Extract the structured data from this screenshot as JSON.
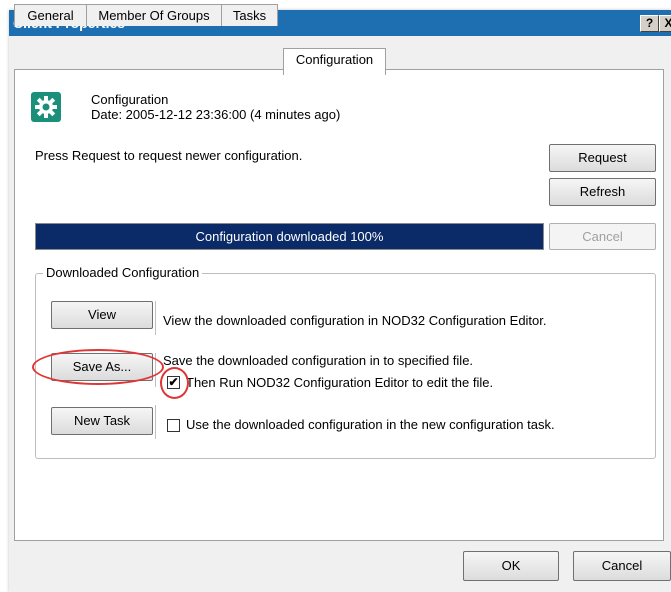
{
  "window": {
    "title": "Client Properties",
    "help_button": "?",
    "close_button": "X"
  },
  "tabs": [
    {
      "label": "General"
    },
    {
      "label": "Member Of Groups"
    },
    {
      "label": "Tasks"
    },
    {
      "label": "Configuration"
    }
  ],
  "active_tab": "Configuration",
  "header": {
    "icon": "gear-icon",
    "title": "Configuration",
    "date_label": "Date: 2005-12-12 23:36:00 (4 minutes ago)"
  },
  "instruction": "Press Request to request newer configuration.",
  "buttons": {
    "request": "Request",
    "refresh": "Refresh",
    "cancel_progress": "Cancel",
    "view": "View",
    "save_as": "Save As...",
    "new_task": "New Task",
    "ok": "OK",
    "cancel": "Cancel"
  },
  "progress": {
    "label": "Configuration downloaded 100%",
    "percent": 100
  },
  "downloaded_group": {
    "title": "Downloaded Configuration",
    "view_desc": "View the downloaded configuration in NOD32 Configuration Editor.",
    "save_desc": "Save the downloaded configuration in to specified file.",
    "run_editor_label": "Then Run NOD32 Configuration Editor to edit the file.",
    "run_editor_checked": true,
    "new_task_label": "Use the downloaded configuration in the new configuration task.",
    "new_task_checked": false
  },
  "colors": {
    "titlebar": "#1e6fb2",
    "progress_fill": "#0a2a68",
    "annotation": "#e03535",
    "icon_bg": "#1a8f7a"
  }
}
